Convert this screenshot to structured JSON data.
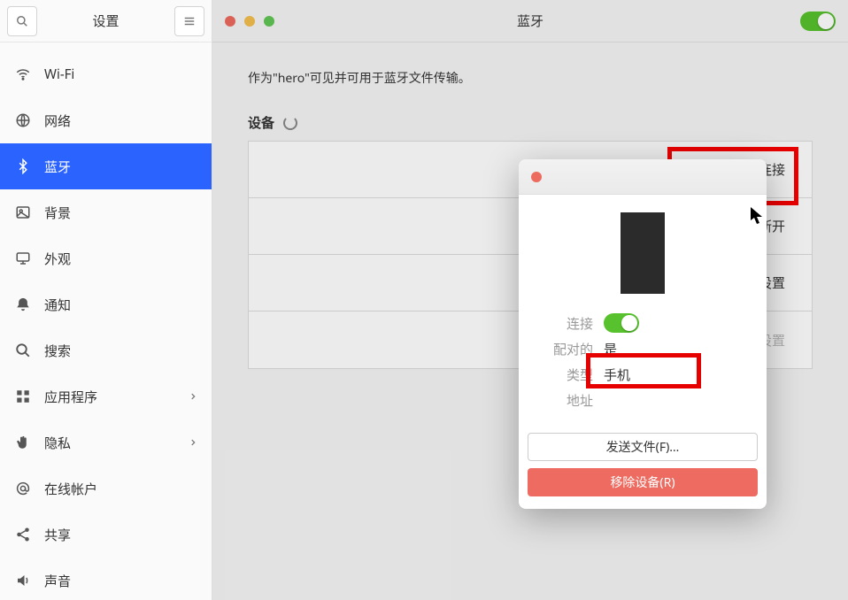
{
  "sidebar": {
    "title": "设置",
    "items": [
      {
        "label": "Wi-Fi"
      },
      {
        "label": "网络"
      },
      {
        "label": "蓝牙"
      },
      {
        "label": "背景"
      },
      {
        "label": "外观"
      },
      {
        "label": "通知"
      },
      {
        "label": "搜索"
      },
      {
        "label": "应用程序"
      },
      {
        "label": "隐私"
      },
      {
        "label": "在线帐户"
      },
      {
        "label": "共享"
      },
      {
        "label": "声音"
      }
    ]
  },
  "main": {
    "header_title": "蓝牙",
    "status_text": "作为\"hero\"可见并可用于蓝牙文件传输。",
    "devices_label": "设备",
    "device_rows": [
      {
        "status": "已连接"
      },
      {
        "status": "已断开"
      },
      {
        "status": "未设置"
      },
      {
        "status": "未设置"
      }
    ]
  },
  "modal": {
    "props": {
      "connect_label": "连接",
      "paired_label": "配对的",
      "paired_value": "是",
      "type_label": "类型",
      "type_value": "手机",
      "address_label": "地址",
      "address_value": ""
    },
    "buttons": {
      "send_file": "发送文件(F)…",
      "remove_device": "移除设备(R)"
    }
  }
}
